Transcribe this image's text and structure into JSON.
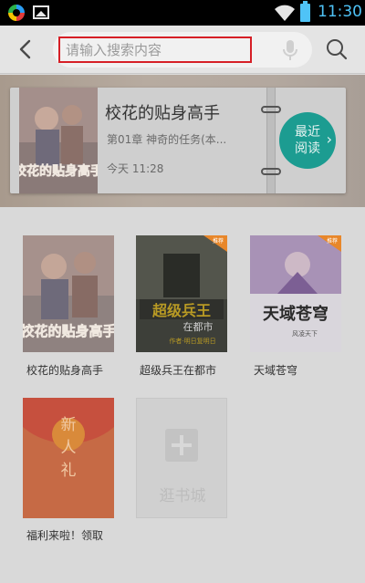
{
  "status_bar": {
    "time": "11:30"
  },
  "search": {
    "placeholder": "请输入搜索内容",
    "value": ""
  },
  "recent": {
    "title": "校花的贴身高手",
    "chapter": "第01章 神奇的任务(本...",
    "time": "今天 11:28",
    "button_line1": "最近",
    "button_line2": "阅读",
    "cover_text": "校花的贴身高手"
  },
  "books": [
    {
      "title": "校花的贴身高手",
      "cover_text": "校花的贴身高手",
      "badge": ""
    },
    {
      "title": "超级兵王在都市",
      "cover_text": "超级兵王",
      "cover_sub": "在都市",
      "cover_author": "作者·明日复明日",
      "badge": "推荐"
    },
    {
      "title": "天域苍穹",
      "cover_text": "天域苍穹",
      "cover_author": "风凌天下",
      "badge": "推荐"
    }
  ],
  "welfare": {
    "title": "福利来啦！领取",
    "text": "新人礼"
  },
  "add_tile": {
    "label": "逛书城"
  },
  "colors": {
    "accent_red": "#d61f26",
    "teal": "#1c9c91",
    "status_blue": "#4fc3f7",
    "badge_orange": "#e8872a"
  }
}
